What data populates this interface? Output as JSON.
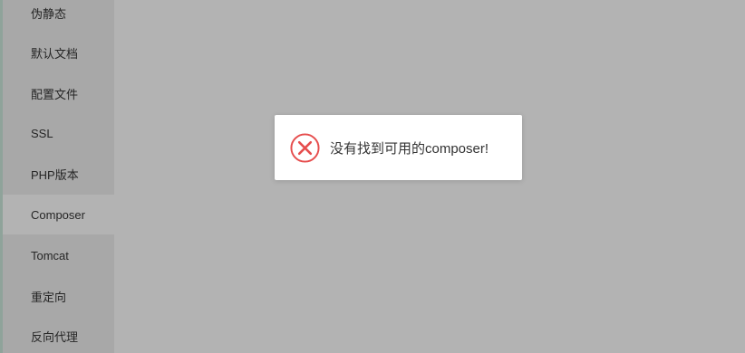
{
  "sidebar": {
    "items": [
      {
        "label": "伪静态"
      },
      {
        "label": "默认文档"
      },
      {
        "label": "配置文件"
      },
      {
        "label": "SSL"
      },
      {
        "label": "PHP版本"
      },
      {
        "label": "Composer"
      },
      {
        "label": "Tomcat"
      },
      {
        "label": "重定向"
      },
      {
        "label": "反向代理"
      }
    ],
    "active_item": "Composer"
  },
  "message": {
    "icon": "error-circle-x-icon",
    "text": "没有找到可用的composer!",
    "accent_color": "#e64d4d"
  },
  "colors": {
    "overlay": "#b3b3b3",
    "sidebar": "#a8a8a8",
    "dialog_bg": "#ffffff"
  }
}
